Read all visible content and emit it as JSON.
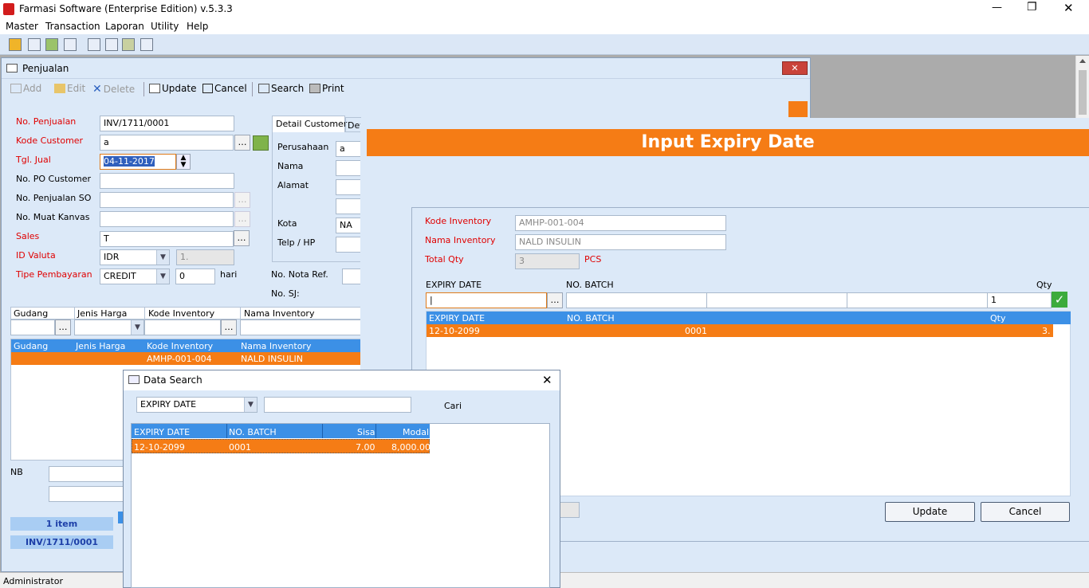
{
  "app": {
    "title": "Farmasi Software (Enterprise Edition) v.5.3.3",
    "controls": {
      "minimize": "—",
      "maximize": "❐",
      "close": "✕"
    }
  },
  "menu": [
    "Master",
    "Transaction",
    "Laporan",
    "Utility",
    "Help"
  ],
  "penjualan": {
    "title": "Penjualan",
    "toolbar": {
      "add": "Add",
      "edit": "Edit",
      "delete": "Delete",
      "update": "Update",
      "cancel": "Cancel",
      "search": "Search",
      "print": "Print"
    },
    "labels": {
      "no_penjualan": "No. Penjualan",
      "kode_customer": "Kode Customer",
      "tgl_jual": "Tgl. Jual",
      "no_po": "No. PO Customer",
      "no_penjualan_so": "No. Penjualan SO",
      "no_muat": "No. Muat Kanvas",
      "sales": "Sales",
      "id_valuta": "ID Valuta",
      "tipe_pembayaran": "Tipe Pembayaran",
      "hari": "hari",
      "no_nota_ref": "No. Nota Ref.",
      "no_sj": "No. SJ:"
    },
    "values": {
      "no_penjualan": "INV/1711/0001",
      "kode_customer": "a",
      "tgl_jual": "04-11-2017",
      "sales": "T",
      "id_valuta": "IDR",
      "kurs": "1.",
      "tipe_pembayaran": "CREDIT",
      "hari": "0"
    },
    "tabs": [
      "Detail Customer",
      "Det"
    ],
    "customer": {
      "labels": {
        "perusahaan": "Perusahaan",
        "nama": "Nama",
        "alamat": "Alamat",
        "kota": "Kota",
        "telp": "Telp / HP"
      },
      "values": {
        "perusahaan": "a",
        "kota": "NA"
      }
    },
    "grid_filter_headers": [
      "Gudang",
      "Jenis Harga",
      "Kode Inventory",
      "Nama Inventory"
    ],
    "grid": {
      "headers": [
        "Gudang",
        "Jenis Harga",
        "Kode Inventory",
        "Nama Inventory"
      ],
      "row": {
        "gudang": "",
        "jenis_harga": "",
        "kode": "AMHP-001-004",
        "nama": "NALD INSULIN"
      }
    },
    "nb_label": "NB",
    "summary": {
      "items": "1 item",
      "invoice": "INV/1711/0001"
    }
  },
  "status": {
    "user": "Administrator"
  },
  "expiry": {
    "title": "Input Expiry Date",
    "labels": {
      "kode_inventory": "Kode Inventory",
      "nama_inventory": "Nama Inventory",
      "total_qty": "Total Qty",
      "pcs": "PCS",
      "expiry_date": "EXPIRY DATE",
      "no_batch": "NO. BATCH",
      "qty": "Qty"
    },
    "values": {
      "kode_inventory": "AMHP-001-004",
      "nama_inventory": "NALD INSULIN",
      "total_qty": "3",
      "qty_input": "1"
    },
    "grid": {
      "headers": [
        "EXPIRY DATE",
        "NO. BATCH",
        "Qty"
      ],
      "row": {
        "expiry": "12-10-2099",
        "batch": "0001",
        "qty": "3."
      }
    },
    "buttons": {
      "update": "Update",
      "cancel": "Cancel"
    }
  },
  "search": {
    "title": "Data Search",
    "field": "EXPIRY DATE",
    "cari": "Cari",
    "headers": [
      "EXPIRY DATE",
      "NO. BATCH",
      "Sisa",
      "Modal"
    ],
    "row": {
      "expiry": "12-10-2099",
      "batch": "0001",
      "sisa": "7.00",
      "modal": "8,000.00"
    }
  },
  "colors": {
    "accent": "#f57c15",
    "grid_header": "#3c90e6",
    "form_bg": "#dce9f8"
  }
}
